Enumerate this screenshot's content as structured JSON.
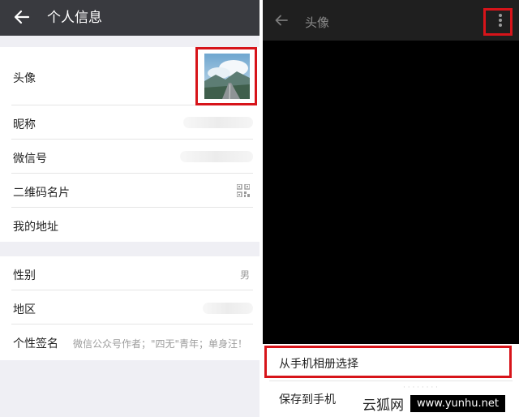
{
  "left_screen": {
    "header": {
      "title": "个人信息"
    },
    "rows": [
      {
        "label": "头像"
      },
      {
        "label": "昵称"
      },
      {
        "label": "微信号"
      },
      {
        "label": "二维码名片"
      },
      {
        "label": "我的地址"
      },
      {
        "label": "性别",
        "value": "男"
      },
      {
        "label": "地区"
      },
      {
        "label": "个性签名",
        "value": "微信公众号作者；\"四无\"青年；单身汪！"
      }
    ]
  },
  "right_screen": {
    "header": {
      "title": "头像"
    },
    "sheet": {
      "choose_from_album": "从手机相册选择",
      "save_to_phone": "保存到手机"
    }
  },
  "watermark": {
    "site_name": "云狐网",
    "site_url": "www.yunhu.net"
  },
  "colors": {
    "header_bg": "#393a3f",
    "highlight_red": "#d7141a",
    "page_bg": "#efeff4"
  }
}
